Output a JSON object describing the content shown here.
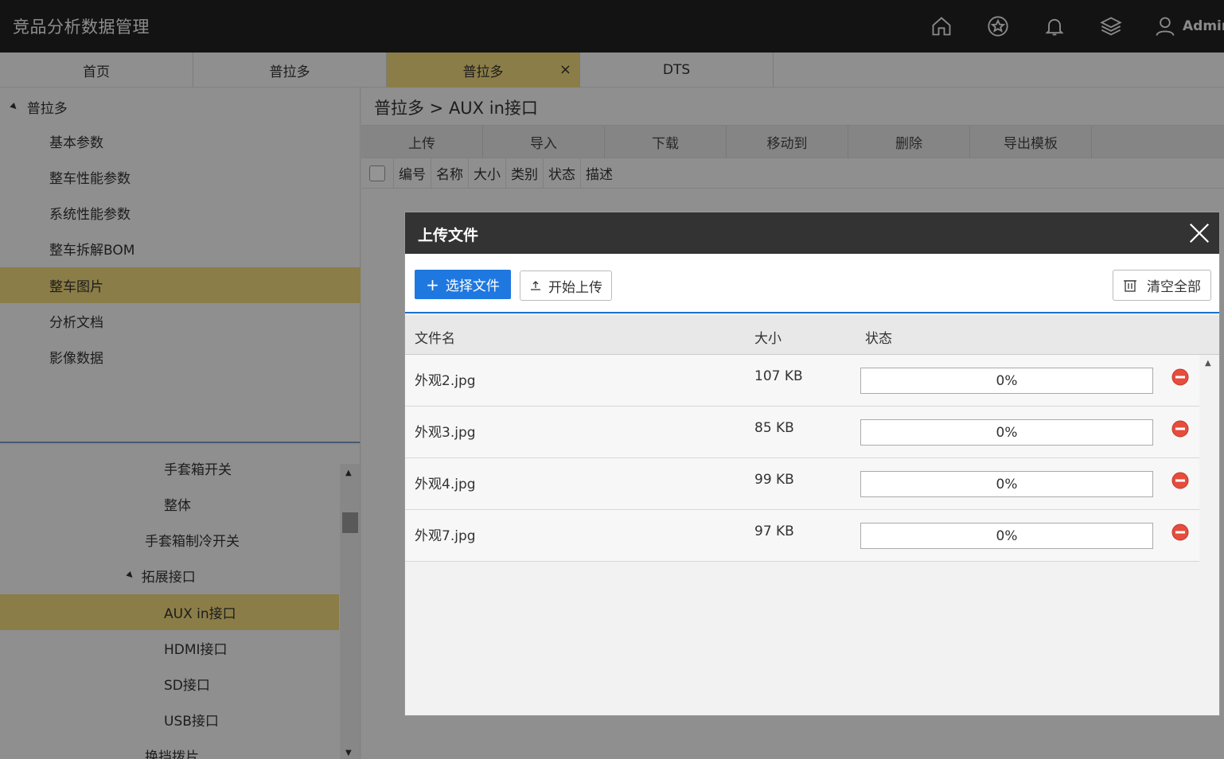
{
  "app": {
    "title": "竞品分析数据管理",
    "user": "Admin"
  },
  "topbar": {
    "icons": [
      "home-icon",
      "star-icon",
      "bell-icon",
      "layers-icon",
      "user-icon"
    ]
  },
  "tabs": [
    {
      "label": "首页"
    },
    {
      "label": "普拉多"
    },
    {
      "label": "普拉多",
      "active": true,
      "close": "×"
    },
    {
      "label": "DTS"
    }
  ],
  "sidebar_top": {
    "root": "普拉多",
    "items": [
      "基本参数",
      "整车性能参数",
      "系统性能参数",
      "整车拆解BOM",
      "整车图片",
      "分析文档",
      "影像数据"
    ],
    "active_index": 4
  },
  "sidebar_bottom": {
    "items": [
      {
        "label": "手套箱开关",
        "indent": 206
      },
      {
        "label": "整体",
        "indent": 206
      },
      {
        "label": "手套箱制冷开关",
        "indent": 182
      },
      {
        "label": "拓展接口",
        "indent": 160,
        "expanded": true
      },
      {
        "label": "AUX in接口",
        "indent": 206,
        "active": true
      },
      {
        "label": "HDMI接口",
        "indent": 206
      },
      {
        "label": "SD接口",
        "indent": 206
      },
      {
        "label": "USB接口",
        "indent": 206
      },
      {
        "label": "换挡拨片",
        "indent": 182
      }
    ]
  },
  "main": {
    "breadcrumb": "普拉多 > AUX in接口",
    "toolbar": [
      "上传",
      "导入",
      "下载",
      "移动到",
      "删除",
      "导出模板"
    ],
    "columns": [
      "编号",
      "名称",
      "大小",
      "类别",
      "状态",
      "描述"
    ]
  },
  "modal": {
    "title": "上传文件",
    "pick_label": "选择文件",
    "upload_label": "开始上传",
    "clear_label": "清空全部",
    "headers": {
      "name": "文件名",
      "size": "大小",
      "status": "状态"
    },
    "files": [
      {
        "name": "外观2.jpg",
        "size": "107 KB",
        "progress": "0%"
      },
      {
        "name": "外观3.jpg",
        "size": "85 KB",
        "progress": "0%"
      },
      {
        "name": "外观4.jpg",
        "size": "99 KB",
        "progress": "0%"
      },
      {
        "name": "外观7.jpg",
        "size": "97 KB",
        "progress": "0%"
      }
    ]
  },
  "colors": {
    "topbar": "#222222",
    "highlight": "#f0d77a",
    "primary": "#1e78e0",
    "remove": "#e74c3c"
  }
}
